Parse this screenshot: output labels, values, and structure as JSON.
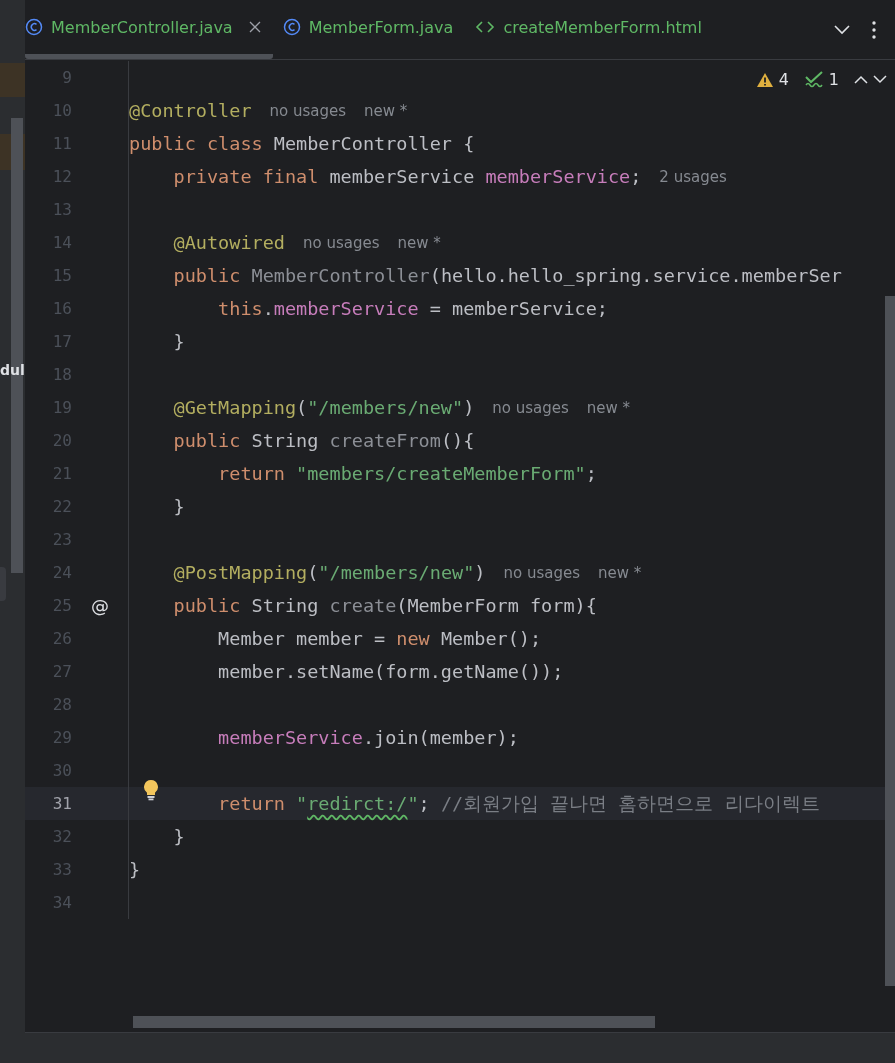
{
  "side_panel": {
    "label": "dul"
  },
  "tabs": [
    {
      "label": "MemberController.java",
      "kind": "java",
      "selected": true,
      "closable": true
    },
    {
      "label": "MemberForm.java",
      "kind": "java",
      "selected": false,
      "closable": false
    },
    {
      "label": "createMemberForm.html",
      "kind": "html",
      "selected": false,
      "closable": false
    }
  ],
  "inspections": {
    "warnings": "4",
    "passed": "1"
  },
  "lines": [
    {
      "number": "9",
      "current": false,
      "bulb": false
    },
    {
      "number": "10",
      "current": false,
      "bulb": false,
      "tokens": [
        {
          "kind": "annotation",
          "text": "@Controller"
        },
        {
          "kind": "hint",
          "text": "no usages"
        },
        {
          "kind": "hint",
          "text": "new *"
        }
      ]
    },
    {
      "number": "11",
      "current": false,
      "bulb": false,
      "tokens": [
        {
          "kind": "keyword",
          "text": "public class "
        },
        {
          "kind": "plain",
          "text": "MemberController {"
        }
      ]
    },
    {
      "number": "12",
      "current": false,
      "bulb": false,
      "tokens": [
        {
          "kind": "keyword",
          "text": "    private final "
        },
        {
          "kind": "plain",
          "text": "memberService "
        },
        {
          "kind": "field",
          "text": "memberService"
        },
        {
          "kind": "plain",
          "text": ";"
        },
        {
          "kind": "hint",
          "text": "2 usages"
        }
      ]
    },
    {
      "number": "13",
      "current": false,
      "bulb": false
    },
    {
      "number": "14",
      "current": false,
      "bulb": false,
      "tokens": [
        {
          "kind": "annotation",
          "text": "    @Autowired"
        },
        {
          "kind": "hint",
          "text": "no usages"
        },
        {
          "kind": "hint",
          "text": "new *"
        }
      ]
    },
    {
      "number": "15",
      "current": false,
      "bulb": false,
      "tokens": [
        {
          "kind": "keyword",
          "text": "    public "
        },
        {
          "kind": "unused",
          "text": "MemberController"
        },
        {
          "kind": "plain",
          "text": "(hello.hello_spring.service.memberSer"
        }
      ]
    },
    {
      "number": "16",
      "current": false,
      "bulb": false,
      "tokens": [
        {
          "kind": "keyword",
          "text": "        this"
        },
        {
          "kind": "plain",
          "text": "."
        },
        {
          "kind": "field",
          "text": "memberService"
        },
        {
          "kind": "plain",
          "text": " = memberService;"
        }
      ]
    },
    {
      "number": "17",
      "current": false,
      "bulb": false,
      "tokens": [
        {
          "kind": "plain",
          "text": "    }"
        }
      ]
    },
    {
      "number": "18",
      "current": false,
      "bulb": false
    },
    {
      "number": "19",
      "current": false,
      "bulb": false,
      "tokens": [
        {
          "kind": "annotation",
          "text": "    @GetMapping"
        },
        {
          "kind": "plain",
          "text": "("
        },
        {
          "kind": "string",
          "text": "\"/members/new\""
        },
        {
          "kind": "plain",
          "text": ")"
        },
        {
          "kind": "hint",
          "text": "no usages"
        },
        {
          "kind": "hint",
          "text": "new *"
        }
      ]
    },
    {
      "number": "20",
      "current": false,
      "bulb": false,
      "tokens": [
        {
          "kind": "keyword",
          "text": "    public "
        },
        {
          "kind": "plain",
          "text": "String "
        },
        {
          "kind": "unused",
          "text": "createFrom"
        },
        {
          "kind": "plain",
          "text": "(){"
        }
      ]
    },
    {
      "number": "21",
      "current": false,
      "bulb": false,
      "tokens": [
        {
          "kind": "keyword",
          "text": "        return "
        },
        {
          "kind": "string",
          "text": "\"members/createMemberForm\""
        },
        {
          "kind": "plain",
          "text": ";"
        }
      ]
    },
    {
      "number": "22",
      "current": false,
      "bulb": false,
      "tokens": [
        {
          "kind": "plain",
          "text": "    }"
        }
      ]
    },
    {
      "number": "23",
      "current": false,
      "bulb": false
    },
    {
      "number": "24",
      "current": false,
      "bulb": false,
      "tokens": [
        {
          "kind": "annotation",
          "text": "    @PostMapping"
        },
        {
          "kind": "plain",
          "text": "("
        },
        {
          "kind": "string",
          "text": "\"/members/new\""
        },
        {
          "kind": "plain",
          "text": ")"
        },
        {
          "kind": "hint",
          "text": "no usages"
        },
        {
          "kind": "hint",
          "text": "new *"
        }
      ]
    },
    {
      "number": "25",
      "gutter": "@",
      "current": false,
      "bulb": false,
      "tokens": [
        {
          "kind": "keyword",
          "text": "    public "
        },
        {
          "kind": "plain",
          "text": "String "
        },
        {
          "kind": "unused",
          "text": "create"
        },
        {
          "kind": "plain",
          "text": "(MemberForm form){"
        }
      ]
    },
    {
      "number": "26",
      "current": false,
      "bulb": false,
      "tokens": [
        {
          "kind": "plain",
          "text": "        Member member = "
        },
        {
          "kind": "keyword",
          "text": "new "
        },
        {
          "kind": "plain",
          "text": "Member();"
        }
      ]
    },
    {
      "number": "27",
      "current": false,
      "bulb": false,
      "tokens": [
        {
          "kind": "plain",
          "text": "        member.setName(form.getName());"
        }
      ]
    },
    {
      "number": "28",
      "current": false,
      "bulb": false
    },
    {
      "number": "29",
      "current": false,
      "bulb": false,
      "tokens": [
        {
          "kind": "field",
          "text": "        memberService"
        },
        {
          "kind": "plain",
          "text": ".join(member);"
        }
      ]
    },
    {
      "number": "30",
      "current": false,
      "bulb": false
    },
    {
      "number": "31",
      "current": true,
      "bulb": true,
      "tokens": [
        {
          "kind": "keyword",
          "text": "        return "
        },
        {
          "kind": "string",
          "text": "\""
        },
        {
          "kind": "typo",
          "text": "redirct:/"
        },
        {
          "kind": "string",
          "text": "\""
        },
        {
          "kind": "plain",
          "text": "; "
        },
        {
          "kind": "comment",
          "text": "//회원가입 끝나면 홈하면으로 리다이렉트"
        }
      ]
    },
    {
      "number": "32",
      "current": false,
      "bulb": false,
      "tokens": [
        {
          "kind": "plain",
          "text": "    }"
        }
      ]
    },
    {
      "number": "33",
      "current": false,
      "bulb": false,
      "tokens": [
        {
          "kind": "plain",
          "text": "}"
        }
      ]
    },
    {
      "number": "34",
      "current": false,
      "bulb": false
    }
  ]
}
